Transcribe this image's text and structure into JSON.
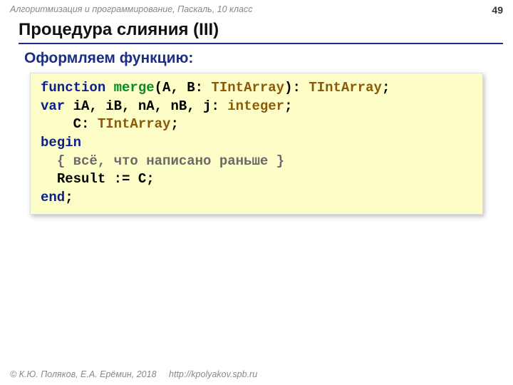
{
  "header": {
    "course": "Алгоритмизация и программирование, Паскаль, 10 класс",
    "page_number": "49"
  },
  "title": "Процедура слияния (III)",
  "subtitle": "Оформляем функцию:",
  "code": {
    "l1": {
      "kw1": "function",
      "fn": "merge",
      "sig_mid": "(A, B: ",
      "type1": "TIntArray",
      "sig_after": "): ",
      "type2": "TIntArray",
      "semi": ";"
    },
    "l2": {
      "kw": "var",
      "mid": " iA, iB, nA, nB, j: ",
      "type": "integer",
      "semi": ";"
    },
    "l3": {
      "indent": "    ",
      "txt": "C: ",
      "type": "TIntArray",
      "semi": ";"
    },
    "l4": {
      "kw": "begin"
    },
    "l5": {
      "indent": "  ",
      "cmt": "{ всё, что написано раньше }"
    },
    "l6": {
      "indent": "  ",
      "txt": "Result := C;"
    },
    "l7": {
      "kw": "end",
      "semi": ";"
    }
  },
  "footer": {
    "copyright": "© К.Ю. Поляков, Е.А. Ерёмин, 2018",
    "link": "http://kpolyakov.spb.ru"
  }
}
